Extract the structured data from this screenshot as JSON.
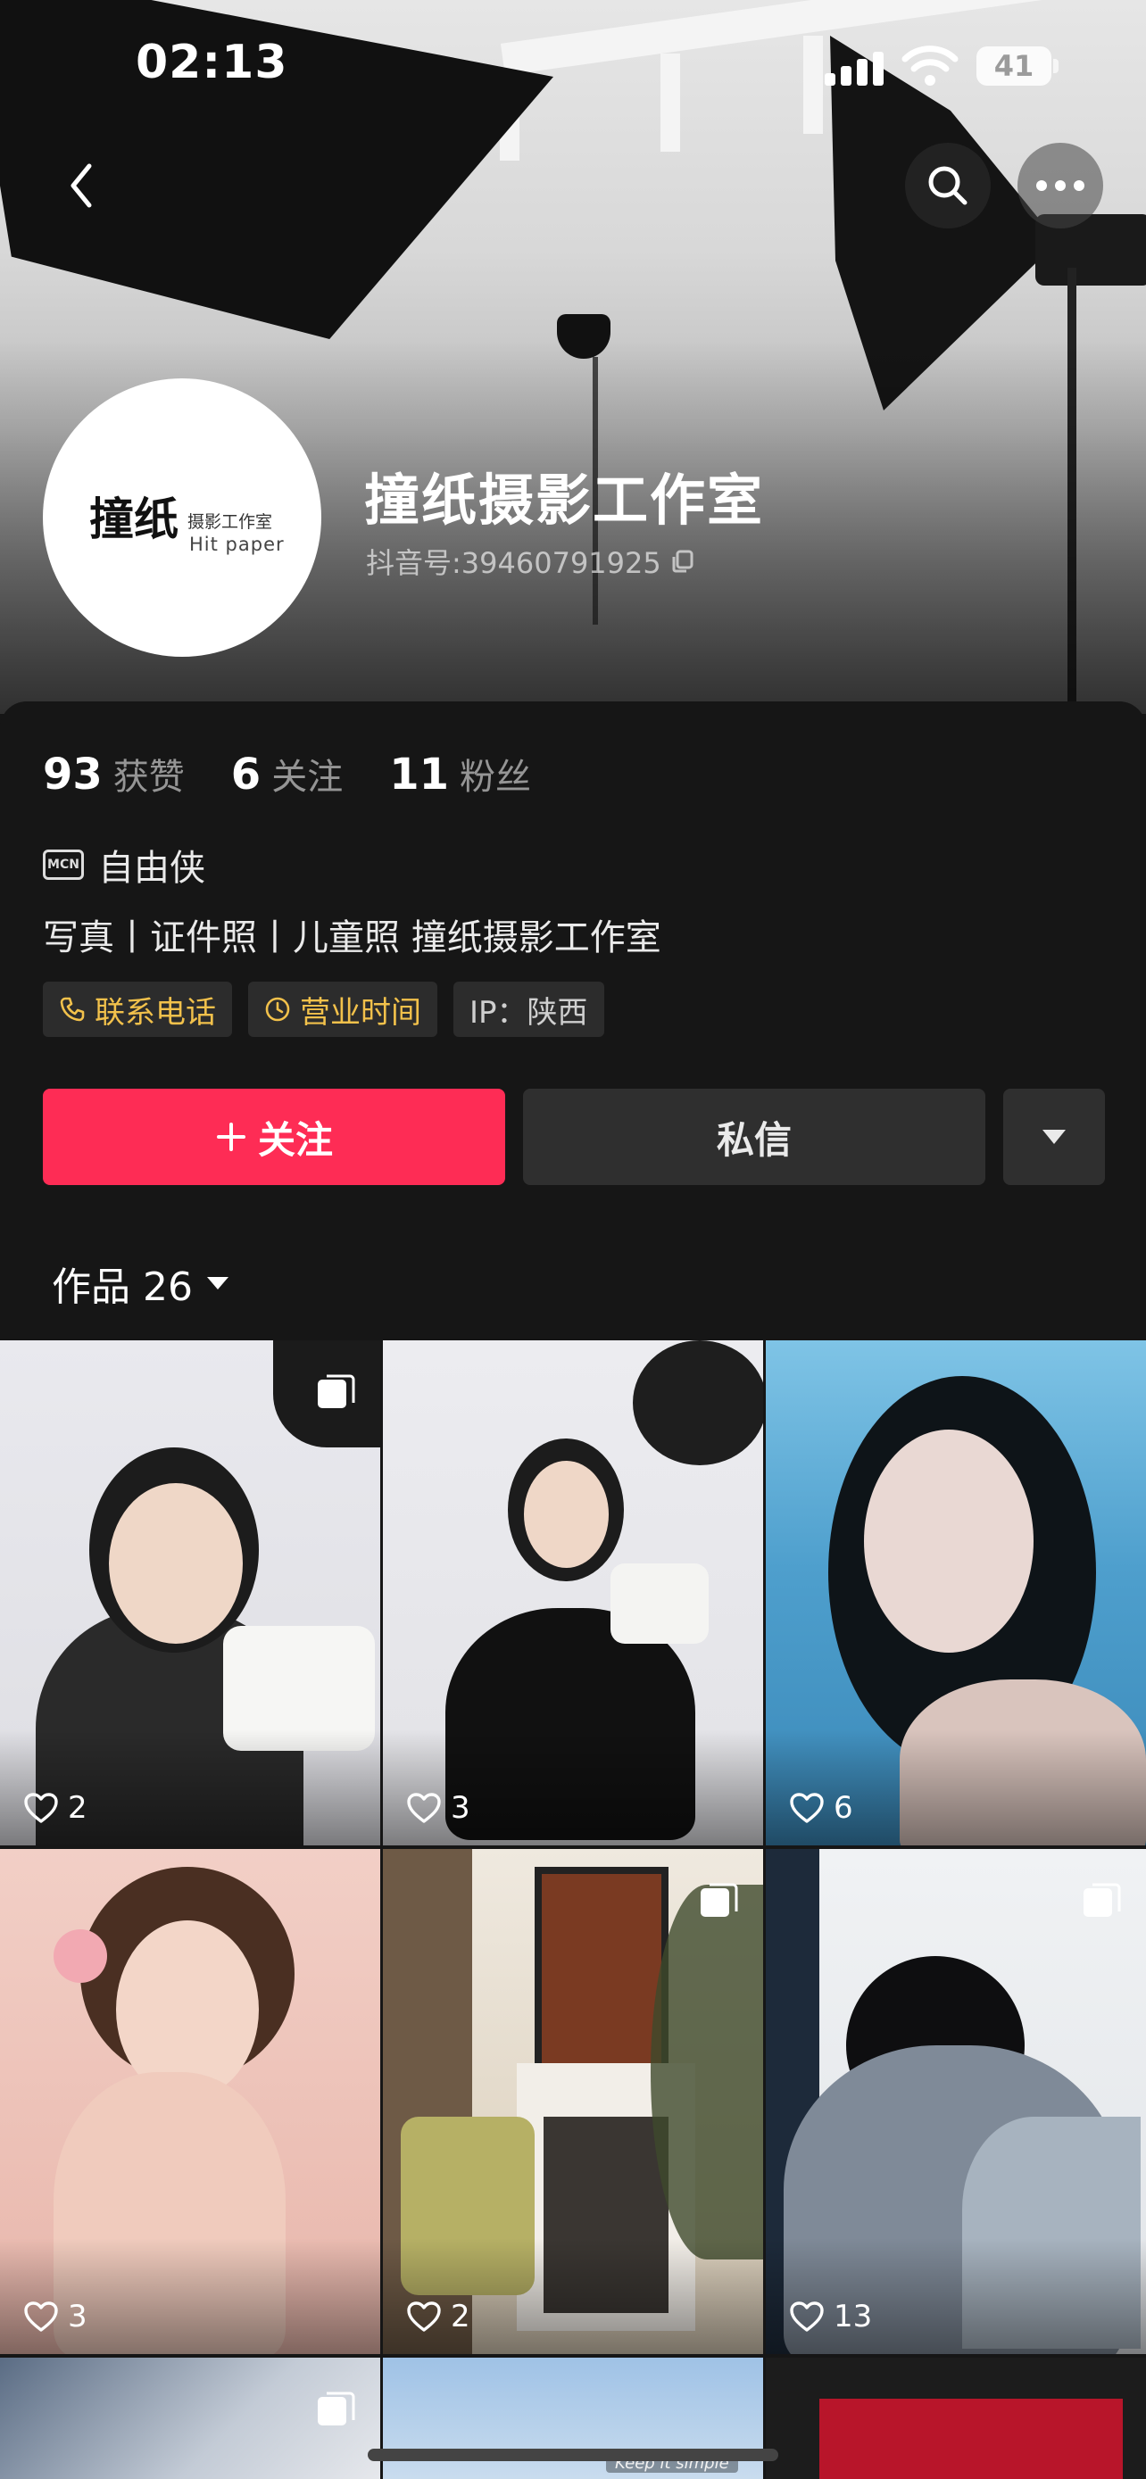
{
  "status_bar": {
    "time": "02:13",
    "battery": "41"
  },
  "profile": {
    "name": "撞纸摄影工作室",
    "douyin_id": "抖音号:39460791925",
    "avatar_logo_main": "撞纸",
    "avatar_logo_sub1": "摄影工作室",
    "avatar_logo_sub2": "Hit paper",
    "stats": [
      {
        "value": "93",
        "label": "获赞"
      },
      {
        "value": "6",
        "label": "关注"
      },
      {
        "value": "11",
        "label": "粉丝"
      }
    ],
    "mcn_label": "自由侠",
    "bio": "写真丨证件照丨儿童照  撞纸摄影工作室",
    "tags": [
      {
        "label": "联系电话",
        "icon": "phone-icon"
      },
      {
        "label": "营业时间",
        "icon": "clock-icon"
      },
      {
        "label": "IP：陕西"
      }
    ]
  },
  "actions": {
    "follow": "关注",
    "message": "私信"
  },
  "works_tab": {
    "label": "作品 26"
  },
  "grid": [
    {
      "likes": "2",
      "multi": true
    },
    {
      "likes": "3",
      "multi": false
    },
    {
      "likes": "6",
      "multi": false
    },
    {
      "likes": "3",
      "multi": false
    },
    {
      "likes": "2",
      "multi": true
    },
    {
      "likes": "13",
      "multi": true
    }
  ],
  "bottom_peek": {
    "caption": "Keep it simple"
  },
  "colors": {
    "accent": "#fe2c55",
    "tag_gold": "#f2c14b",
    "background": "#161616"
  }
}
